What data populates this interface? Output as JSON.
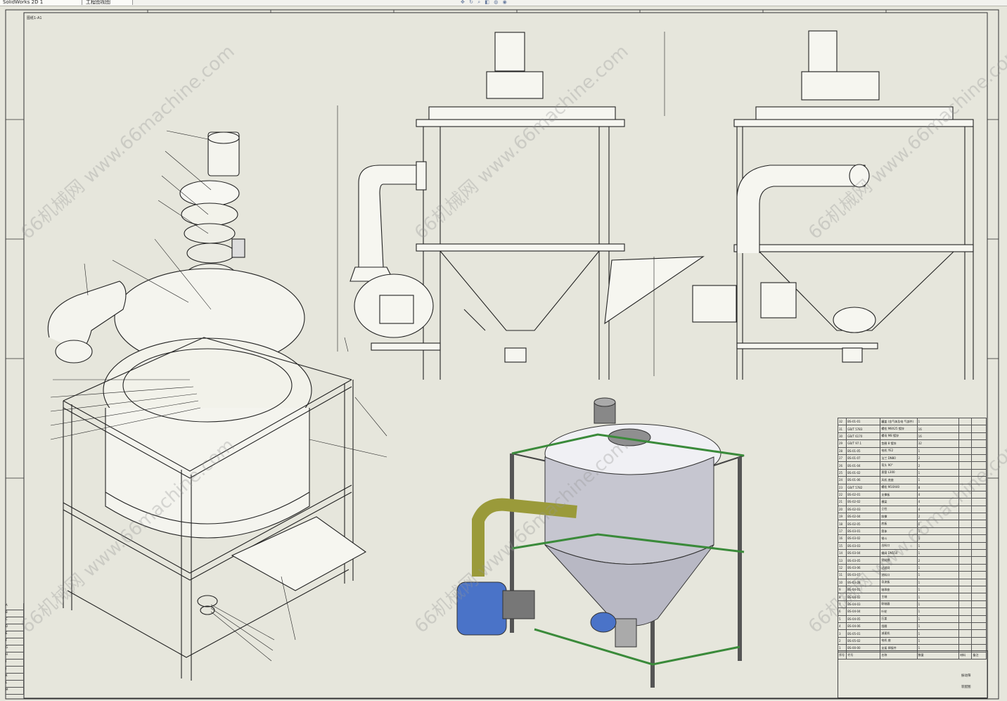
{
  "tabs": [
    {
      "label": "SolidWorks 2D 1"
    },
    {
      "label": "工程图视图"
    }
  ],
  "toolbar": {
    "icons": [
      "pan-icon",
      "rotate-icon",
      "zoom-icon",
      "view-icon",
      "display-icon",
      "hide-show-icon"
    ]
  },
  "sheet": {
    "label": "图纸1-A1"
  },
  "watermark": {
    "text": "66机械网 www.66machine.com"
  },
  "bom": {
    "rows": [
      [
        "32",
        "BS-01-01",
        "罐盖 (含气体及电 气部件)",
        "1",
        "",
        ""
      ],
      [
        "31",
        "GB/T 5783",
        "螺栓 M8X25 镀锌",
        "16",
        "",
        ""
      ],
      [
        "30",
        "GB/T 6170",
        "螺母 M8 镀锌",
        "16",
        "",
        ""
      ],
      [
        "29",
        "GB/T 97.1",
        "垫圈 8 镀锌",
        "32",
        "",
        ""
      ],
      [
        "28",
        "BS-01-05",
        "电机 YE2",
        "1",
        "",
        ""
      ],
      [
        "27",
        "BS-01-07",
        "法兰 DN80",
        "2",
        "",
        ""
      ],
      [
        "26",
        "BS-01-04",
        "弯头 90°",
        "2",
        "",
        ""
      ],
      [
        "25",
        "BS-01-02",
        "直管 L300",
        "1",
        "",
        ""
      ],
      [
        "24",
        "BS-01-06",
        "风机 底座",
        "1",
        "",
        ""
      ],
      [
        "23",
        "GB/T 5782",
        "螺栓 M10X40",
        "8",
        "",
        ""
      ],
      [
        "22",
        "BS-02-01",
        "支撑板",
        "4",
        "",
        ""
      ],
      [
        "21",
        "BS-02-02",
        "横梁",
        "4",
        "",
        ""
      ],
      [
        "20",
        "BS-02-03",
        "立柱",
        "4",
        "",
        ""
      ],
      [
        "19",
        "BS-02-04",
        "斜撑",
        "2",
        "",
        ""
      ],
      [
        "18",
        "BS-02-05",
        "底板",
        "1",
        "",
        ""
      ],
      [
        "17",
        "BS-03-01",
        "筒体",
        "1",
        "",
        ""
      ],
      [
        "16",
        "BS-03-02",
        "锥斗",
        "1",
        "",
        ""
      ],
      [
        "15",
        "BS-03-03",
        "出料口",
        "1",
        "",
        ""
      ],
      [
        "14",
        "BS-03-04",
        "蝶阀 DN150",
        "1",
        "",
        ""
      ],
      [
        "13",
        "BS-03-05",
        "密封圈",
        "2",
        "",
        ""
      ],
      [
        "12",
        "BS-03-06",
        "过滤网",
        "1",
        "",
        ""
      ],
      [
        "11",
        "BS-03-07",
        "进料口",
        "1",
        "",
        ""
      ],
      [
        "10",
        "BS-03-08",
        "导流板",
        "1",
        "",
        ""
      ],
      [
        "9",
        "BS-04-01",
        "轴承座",
        "1",
        "",
        ""
      ],
      [
        "8",
        "BS-04-02",
        "主轴",
        "1",
        "",
        ""
      ],
      [
        "7",
        "BS-04-03",
        "联轴器",
        "1",
        "",
        ""
      ],
      [
        "6",
        "BS-04-04",
        "叶轮",
        "1",
        "",
        ""
      ],
      [
        "5",
        "BS-04-05",
        "压盖",
        "1",
        "",
        ""
      ],
      [
        "4",
        "BS-04-06",
        "挡圈",
        "1",
        "",
        ""
      ],
      [
        "3",
        "BS-05-01",
        "减速机",
        "1",
        "",
        ""
      ],
      [
        "2",
        "BS-05-02",
        "电机 座",
        "1",
        "",
        ""
      ],
      [
        "1",
        "BS-00-00",
        "支架 焊接件",
        "1",
        "",
        ""
      ]
    ],
    "header": [
      "序号",
      "代号",
      "名称",
      "数量",
      "材料",
      "备注"
    ]
  },
  "title_block": {
    "name": "振动筛",
    "sub": "装配图"
  },
  "revisions": [
    "A",
    "B",
    "C",
    "D",
    "E",
    "F",
    "G",
    "H",
    "I",
    "J",
    "K",
    "L",
    "M"
  ],
  "colors": {
    "paper": "#e6e6dc",
    "line": "#222222",
    "steel": "#c8c8d2",
    "frame": "#6d6d78",
    "pipe": "#9a9a3a",
    "blower": "#4a73c8",
    "green": "#3a8a3a"
  }
}
